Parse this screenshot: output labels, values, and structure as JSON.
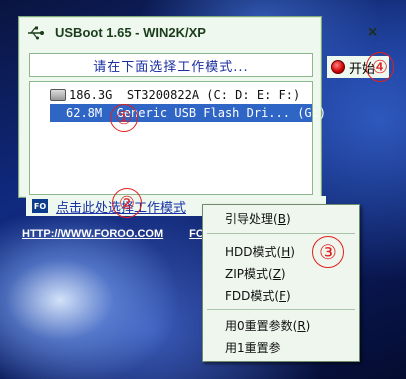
{
  "window": {
    "title": "USBoot 1.65 - WIN2K/XP",
    "banner": "请在下面选择工作模式..."
  },
  "drives": [
    {
      "size": "186.3G",
      "name": "ST3200822A (C: D: E: F:)",
      "icon": "hdd-icon",
      "selected": false
    },
    {
      "size": "62.8M",
      "name": "Generic USB Flash Dri... (G:)",
      "icon": "usb-icon",
      "selected": true
    }
  ],
  "controls": {
    "close_label": "×",
    "start_label": "开始"
  },
  "footer": {
    "icon_text": "FO",
    "mode_link": "点击此处选择工作模式",
    "url": "HTTP://WWW.FOROO.COM",
    "url2": "FO"
  },
  "menu": {
    "items": [
      {
        "label": "引导处理",
        "key": "B"
      },
      {
        "label": "HDD模式",
        "key": "H"
      },
      {
        "label": "ZIP模式",
        "key": "Z"
      },
      {
        "label": "FDD模式",
        "key": "F"
      },
      {
        "label": "用0重置参数",
        "key": "R"
      },
      {
        "label": "用1重置参"
      }
    ]
  },
  "annotations": [
    "①",
    "②",
    "③",
    "④"
  ],
  "colors": {
    "accent": "#2f66c6",
    "annotation": "#e02020",
    "window_bg": "#eef8ee"
  }
}
